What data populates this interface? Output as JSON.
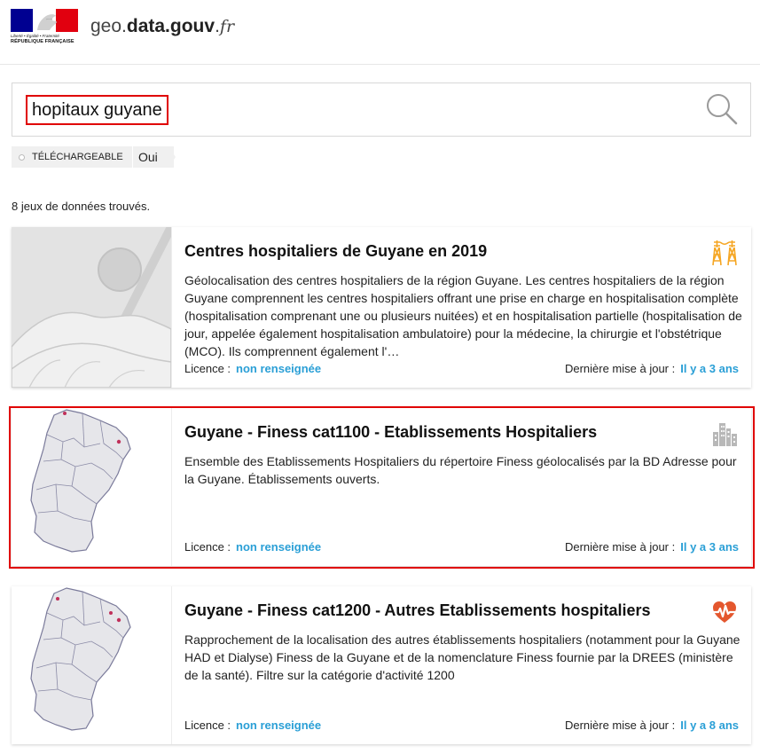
{
  "header": {
    "logo_motto": "Liberté • Égalité • Fraternité",
    "logo_name": "RÉPUBLIQUE FRANÇAISE",
    "site_prefix": "geo.",
    "site_main": "data.gouv",
    "site_dot": ".",
    "site_tld": "fr"
  },
  "search": {
    "query": "hopitaux guyane"
  },
  "facet": {
    "label": "TÉLÉCHARGEABLE",
    "value": "Oui"
  },
  "results_count": "8 jeux de données trouvés.",
  "meta_labels": {
    "licence": "Licence :",
    "updated": "Dernière mise à jour :"
  },
  "results": [
    {
      "title": "Centres hospitaliers de Guyane en 2019",
      "description": "Géolocalisation des centres hospitaliers de la région Guyane. Les centres hospitaliers de la région Guyane comprennent les centres hospitaliers offrant une prise en charge en hospitalisation complète (hospitalisation comprenant une ou plusieurs nuitées) et en hospitalisation partielle (hospitalisation de jour, appelée également hospitalisation ambulatoire) pour la médecine, la chirurgie et l'obstétrique (MCO). Ils comprennent également l'…",
      "licence": "non renseignée",
      "updated": "Il y a 3 ans",
      "icon": "power-pylon-icon"
    },
    {
      "title": "Guyane - Finess cat1100 - Etablissements Hospitaliers",
      "description": "Ensemble des Etablissements Hospitaliers du répertoire Finess géolocalisés par la BD Adresse pour la Guyane. Établissements ouverts.",
      "licence": "non renseignée",
      "updated": "Il y a 3 ans",
      "icon": "buildings-icon"
    },
    {
      "title": "Guyane - Finess cat1200 - Autres Etablissements hospitaliers",
      "description": "Rapprochement de la localisation des autres établissements hospitaliers (notamment pour la Guyane HAD et Dialyse) Finess de la Guyane et de la nomenclature Finess fournie par la DREES (ministère de la santé). Filtre sur la catégorie d'activité 1200",
      "licence": "non renseignée",
      "updated": "Il y a 8 ans",
      "icon": "heart-pulse-icon"
    }
  ],
  "colors": {
    "accent": "#2a9fd6",
    "highlight": "#e00000",
    "icon_orange": "#f5a623",
    "icon_red": "#e4572e"
  }
}
